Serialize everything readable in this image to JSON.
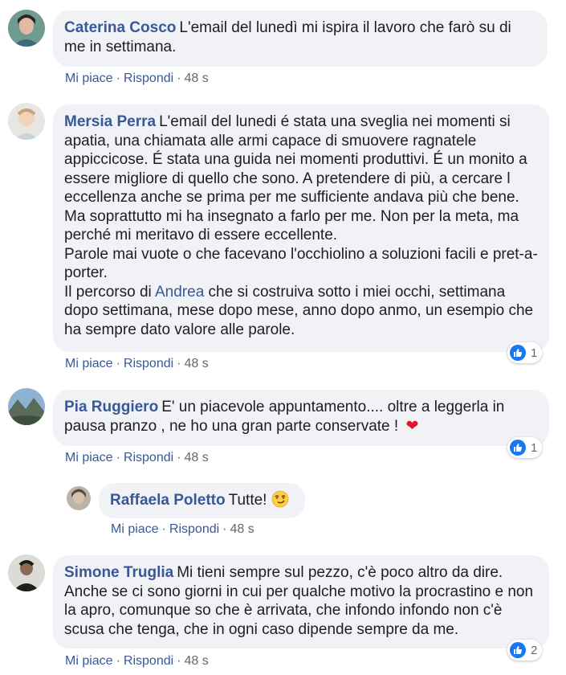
{
  "actions": {
    "like": "Mi piace",
    "reply": "Rispondi",
    "dot": "·"
  },
  "comments": [
    {
      "author": "Caterina Cosco",
      "text": "L'email del lunedì mi ispira il lavoro che farò su di me in settimana.",
      "time": "48 s"
    },
    {
      "author": "Mersia Perra",
      "p1": "L'email del lunedi é stata una sveglia nei momenti si apatia, una chiamata alle armi capace di smuovere ragnatele appiccicose. É stata una guida nei momenti produttivi. É un monito a essere migliore di quello che sono. A pretendere di più, a cercare l eccellenza anche se prima per me sufficiente andava più che bene. Ma soprattutto mi ha insegnato a farlo per me. Non per la meta, ma perché mi meritavo di essere eccellente.",
      "p2": "Parole mai vuote o che facevano l'occhiolino a soluzioni facili e pret-a-porter.",
      "p3_before": "Il percorso di ",
      "mention": "Andrea",
      "p3_after": " che si costruiva sotto i miei occhi, settimana dopo settimana, mese dopo mese, anno dopo anmo, un esempio che ha sempre dato valore alle parole.",
      "time": "48 s",
      "reactions": "1"
    },
    {
      "author": "Pia Ruggiero",
      "text": "E' un piacevole appuntamento.... oltre a leggerla in pausa pranzo , ne ho una gran parte conservate !",
      "emoji": "❤",
      "time": "48 s",
      "reactions": "1"
    },
    {
      "author": "Raffaela Poletto",
      "text": "Tutte!",
      "emoji": "smirk-emoji",
      "time": "48 s"
    },
    {
      "author": "Simone Truglia",
      "text": "Mi tieni sempre sul pezzo, c'è poco altro da dire. Anche se ci sono giorni in cui per qualche motivo la procrastino e non la apro, comunque so che è arrivata, che infondo infondo non c'è scusa che tenga, che in ogni caso dipende sempre da me.",
      "time": "48 s",
      "reactions": "2"
    }
  ]
}
